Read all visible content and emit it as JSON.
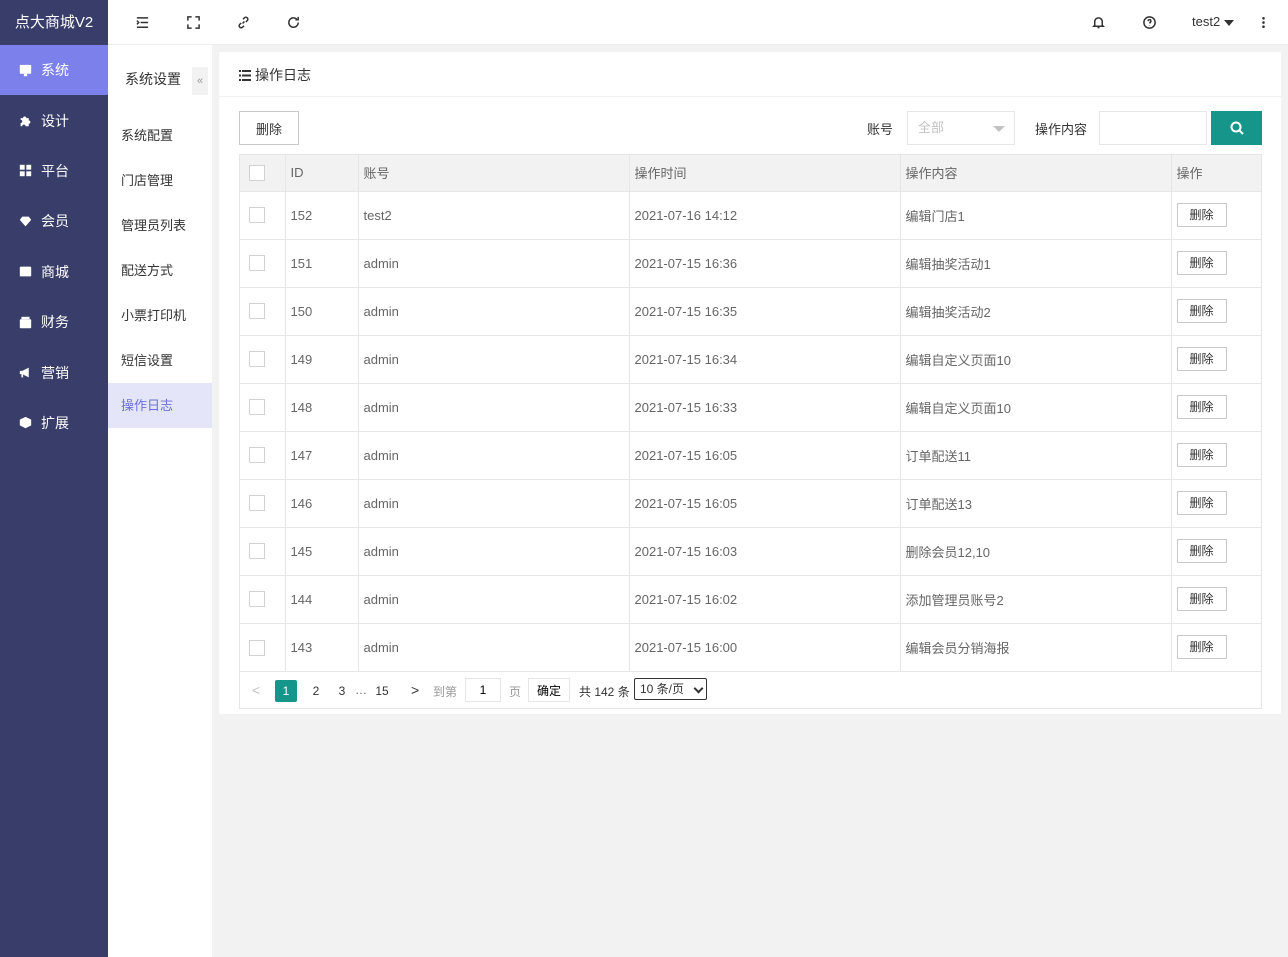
{
  "brand": "点大商城V2",
  "nav": [
    {
      "label": "系统",
      "icon": "monitor-icon"
    },
    {
      "label": "设计",
      "icon": "puzzle-icon"
    },
    {
      "label": "平台",
      "icon": "grid-icon"
    },
    {
      "label": "会员",
      "icon": "diamond-icon"
    },
    {
      "label": "商城",
      "icon": "mail-icon"
    },
    {
      "label": "财务",
      "icon": "wallet-icon"
    },
    {
      "label": "营销",
      "icon": "megaphone-icon"
    },
    {
      "label": "扩展",
      "icon": "cube-icon"
    }
  ],
  "header": {
    "user": "test2"
  },
  "submenu": {
    "title": "系统设置",
    "collapse": "«",
    "items": [
      "系统配置",
      "门店管理",
      "管理员列表",
      "配送方式",
      "小票打印机",
      "短信设置",
      "操作日志"
    ]
  },
  "card": {
    "title": "操作日志",
    "delete_label": "删除",
    "account_label": "账号",
    "account_value": "全部",
    "content_label": "操作内容",
    "content_value": ""
  },
  "table": {
    "headers": [
      "ID",
      "账号",
      "操作时间",
      "操作内容",
      "操作"
    ],
    "row_action": "删除",
    "rows": [
      [
        "152",
        "test2",
        "2021-07-16 14:12",
        "编辑门店1"
      ],
      [
        "151",
        "admin",
        "2021-07-15 16:36",
        "编辑抽奖活动1"
      ],
      [
        "150",
        "admin",
        "2021-07-15 16:35",
        "编辑抽奖活动2"
      ],
      [
        "149",
        "admin",
        "2021-07-15 16:34",
        "编辑自定义页面10"
      ],
      [
        "148",
        "admin",
        "2021-07-15 16:33",
        "编辑自定义页面10"
      ],
      [
        "147",
        "admin",
        "2021-07-15 16:05",
        "订单配送11"
      ],
      [
        "146",
        "admin",
        "2021-07-15 16:05",
        "订单配送13"
      ],
      [
        "145",
        "admin",
        "2021-07-15 16:03",
        "删除会员12,10"
      ],
      [
        "144",
        "admin",
        "2021-07-15 16:02",
        "添加管理员账号2"
      ],
      [
        "143",
        "admin",
        "2021-07-15 16:00",
        "编辑会员分销海报"
      ]
    ]
  },
  "pager": {
    "pages": [
      "1",
      "2",
      "3"
    ],
    "dots": "…",
    "last": "15",
    "goto_prefix": "到第",
    "goto_value": "1",
    "goto_suffix": "页",
    "confirm": "确定",
    "total": "共 142 条",
    "page_size": "10 条/页"
  },
  "colors": {
    "sidebar": "#393d6a",
    "active_nav": "#7b80ea",
    "primary": "#16968a"
  }
}
